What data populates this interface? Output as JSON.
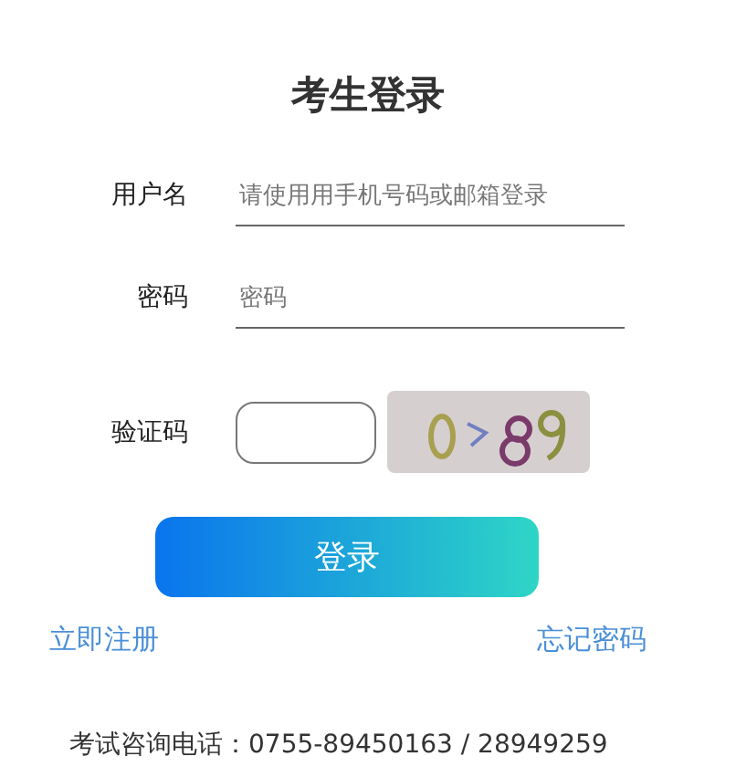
{
  "title": "考生登录",
  "fields": [
    {
      "kind": "line",
      "label": "用户名",
      "placeholder": "请使用用手机号码或邮箱登录"
    },
    {
      "kind": "line",
      "label": "密码",
      "placeholder": "密码"
    },
    {
      "kind": "captcha",
      "label": "验证码"
    }
  ],
  "login_button": "登录",
  "links": [
    "立即注册",
    "忘记密码"
  ],
  "footer": "考试咨询电话：0755-89450163 / 28949259"
}
